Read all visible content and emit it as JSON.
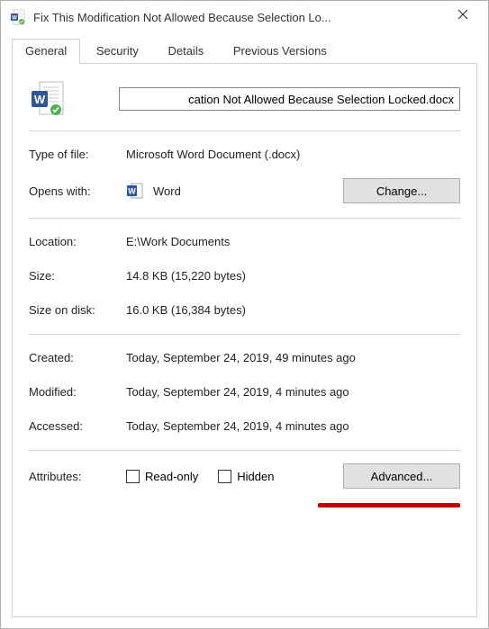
{
  "window": {
    "title": "Fix This Modification Not Allowed Because Selection Lo..."
  },
  "tabs": {
    "general": "General",
    "security": "Security",
    "details": "Details",
    "previous": "Previous Versions"
  },
  "filename": "cation Not Allowed Because Selection Locked.docx",
  "type_of_file": {
    "label": "Type of file:",
    "value": "Microsoft Word Document (.docx)"
  },
  "opens_with": {
    "label": "Opens with:",
    "app": "Word",
    "change_btn": "Change..."
  },
  "location": {
    "label": "Location:",
    "value": "E:\\Work Documents"
  },
  "size": {
    "label": "Size:",
    "value": "14.8 KB (15,220 bytes)"
  },
  "size_on_disk": {
    "label": "Size on disk:",
    "value": "16.0 KB (16,384 bytes)"
  },
  "created": {
    "label": "Created:",
    "value": "Today, September 24, 2019, 49 minutes ago"
  },
  "modified": {
    "label": "Modified:",
    "value": "Today, September 24, 2019, 4 minutes ago"
  },
  "accessed": {
    "label": "Accessed:",
    "value": "Today, September 24, 2019, 4 minutes ago"
  },
  "attributes": {
    "label": "Attributes:",
    "readonly": "Read-only",
    "hidden": "Hidden",
    "advanced_btn": "Advanced..."
  }
}
